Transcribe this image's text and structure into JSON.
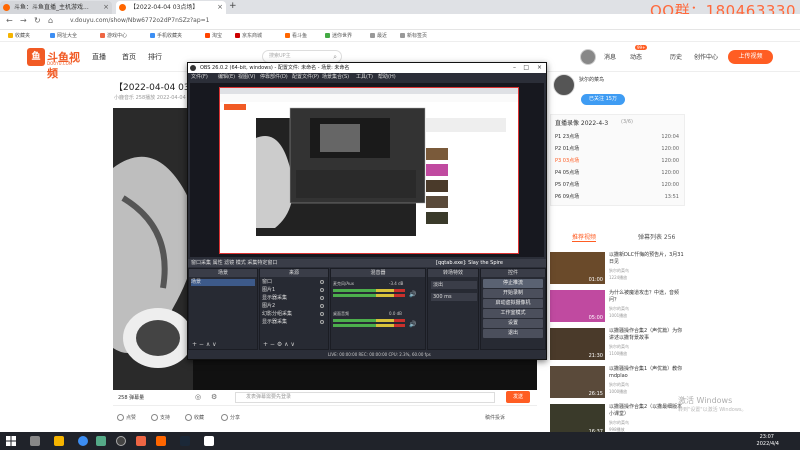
{
  "browser": {
    "tab1": "斗鱼：斗鱼直播_主机游戏...",
    "tab2": "【2022-04-04 03点场】",
    "url": "v.douyu.com/show/Nbw6772o2dP7nSZz?ap=1",
    "overlay": "QQ群：180463330",
    "bookmarks": [
      "收藏夹",
      "网址大全",
      "游戏中心",
      "手机收藏夹",
      "淘宝",
      "京东商城",
      "看斗鱼",
      "迷你世界",
      "最近",
      "新标签页"
    ]
  },
  "site": {
    "logo_main": "斗鱼视频",
    "logo_sub": "DOUYU.COM",
    "nav": [
      "直播",
      "首页",
      "排行"
    ],
    "search_placeholder": "搜索UP主",
    "header_items": [
      "消息",
      "动态",
      "历史",
      "创作中心"
    ],
    "badge": "99+",
    "upload_label": "上传视频"
  },
  "video": {
    "title": "【2022-04-04 03点场】",
    "meta": "小鹿音乐 258播放  2022-04-04",
    "danmu_count": "258 弹幕量",
    "danmu_placeholder": "发个弹幕吧~",
    "danmu_notice": "发表弹幕需要先登录",
    "send_label": "发送",
    "actions": [
      "点赞",
      "支持",
      "收藏",
      "分享"
    ],
    "report": "稿件投诉"
  },
  "up": {
    "name": "狄尔的菜鸟",
    "follow_label": "已关注 15万"
  },
  "playlist": {
    "title": "直播录像 2022-4-3",
    "count": "(3/6)",
    "items": [
      {
        "label": "P1 23点场",
        "dur": "120:04"
      },
      {
        "label": "P2 01点场",
        "dur": "120:00"
      },
      {
        "label": "P3 03点场",
        "dur": "120:00"
      },
      {
        "label": "P4 05点场",
        "dur": "120:00"
      },
      {
        "label": "P5 07点场",
        "dur": "120:00"
      },
      {
        "label": "P6 09点场",
        "dur": "13:51"
      }
    ]
  },
  "recommend": {
    "tabs": [
      "推荐视频",
      "弹幕列表 256"
    ],
    "items": [
      {
        "title": "以撒新DLC忏悔的预告片，3月31日见",
        "author": "狄尔的菜鸟",
        "views": "1224播放",
        "dur": "01:00"
      },
      {
        "title": "为什么被魔道攻击？中途，音频问？",
        "author": "狄尔的菜鸟",
        "views": "1001播放",
        "dur": "05:00"
      },
      {
        "title": "以撒骚操作合集2（声优篇）为你讲述以撒背景故事",
        "author": "狄尔的菜鸟",
        "views": "1100播放",
        "dur": "21:30"
      },
      {
        "title": "以撒骚操作合集1（声优篇）教你mdplao",
        "author": "狄尔的菜鸟",
        "views": "1000播放",
        "dur": "26:15"
      },
      {
        "title": "以撒骚操作合集2（以撒最细版本小课堂）",
        "author": "狄尔的菜鸟",
        "views": "998播放",
        "dur": "16:37"
      }
    ]
  },
  "obs": {
    "title": "OBS 26.0.2 (64-bit, windows) - 配置文件: 未命名 - 场景: 未命名",
    "menu": [
      "文件(F)",
      "编辑(E)",
      "视图(V)",
      "停靠部件(D)",
      "配置文件(P)",
      "场景集合(S)",
      "工具(T)",
      "帮助(H)"
    ],
    "source_bar": "窗口采集    属性   滤镜   模式   采集特定窗口",
    "window_label": "[qqtab.exe]: Slay the Spire",
    "docks": {
      "scenes": "场景",
      "sources": "来源",
      "mixer": "混音器",
      "transitions": "转场特效",
      "controls": "控件"
    },
    "scene_item": "场景",
    "sources": [
      "窗口",
      "图片1",
      "显示器采集",
      "图片2",
      "幻影分组采集",
      "显示器采集"
    ],
    "mixer": [
      {
        "name": "麦克风/Aux",
        "db": "-3.4 dB"
      },
      {
        "name": "桌面音频",
        "db": "0.0 dB"
      }
    ],
    "transition": "淡出",
    "duration": "300 ms",
    "controls": [
      "停止推流",
      "开始录制",
      "启动虚拟摄像机",
      "工作室模式",
      "设置",
      "退出"
    ],
    "status": "LIVE: 00:00:00   REC: 00:00:00   CPU: 2.3%, 60.00 fps"
  },
  "page_overlay": {
    "watermark": "激活 Windows",
    "watermark_sub": "转到\"设置\"以激活 Windows。"
  },
  "taskbar": {
    "time": "23:07",
    "date": "2022/4/4"
  },
  "colors": {
    "accent": "#ff5d23",
    "obs_bg": "#2b2e38",
    "qq_overlay": "#ff6a3d"
  }
}
